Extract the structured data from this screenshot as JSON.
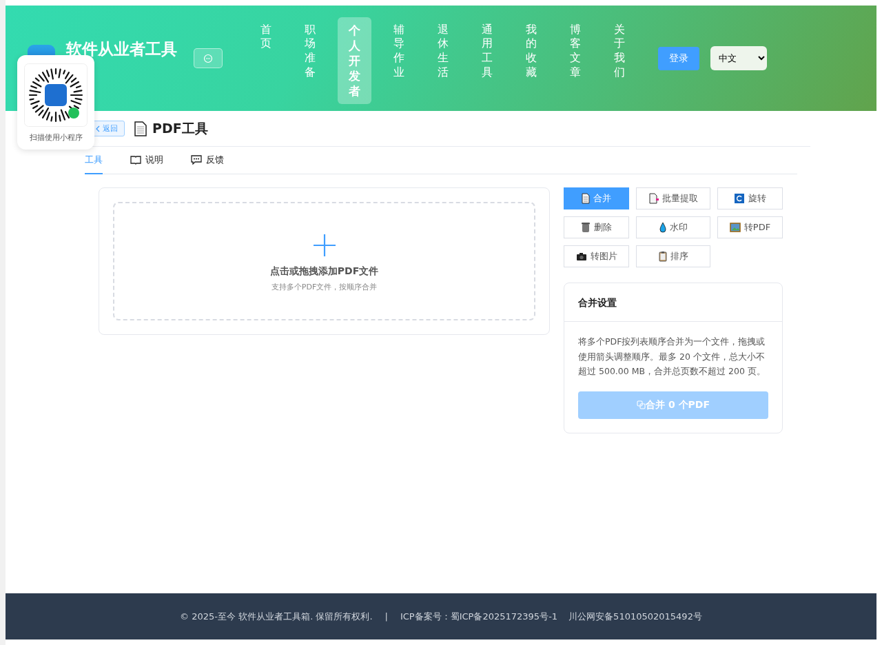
{
  "header": {
    "site_title": "软件从业者工具",
    "nav": [
      {
        "label": "首页",
        "selected": false
      },
      {
        "label": "职场准备",
        "selected": false
      },
      {
        "label": "个人开发者",
        "selected": true
      },
      {
        "label": "辅导作业",
        "selected": false
      },
      {
        "label": "退休生活",
        "selected": false
      },
      {
        "label": "通用工具",
        "selected": false
      },
      {
        "label": "我的收藏",
        "selected": false
      },
      {
        "label": "博客文章",
        "selected": false
      },
      {
        "label": "关于我们",
        "selected": false
      }
    ],
    "login_button": "登录",
    "language": "中文"
  },
  "qr_popup": {
    "caption": "扫描使用小程序"
  },
  "page": {
    "back_button": "返回",
    "title": "PDF工具"
  },
  "tabs": [
    {
      "label": "工具",
      "selected": true
    },
    {
      "label": "说明",
      "selected": false
    },
    {
      "label": "反馈",
      "selected": false
    }
  ],
  "upload": {
    "title": "点击或拖拽添加PDF文件",
    "hint": "支持多个PDF文件，按顺序合并"
  },
  "tools": [
    {
      "label": "合并",
      "selected": true
    },
    {
      "label": "批量提取",
      "selected": false
    },
    {
      "label": "旋转",
      "selected": false
    },
    {
      "label": "删除",
      "selected": false
    },
    {
      "label": "水印",
      "selected": false
    },
    {
      "label": "转PDF",
      "selected": false
    },
    {
      "label": "转图片",
      "selected": false
    },
    {
      "label": "排序",
      "selected": false
    }
  ],
  "settings": {
    "title": "合并设置",
    "description": "将多个PDF按列表顺序合并为一个文件，拖拽或使用箭头调整顺序。最多 20 个文件，总大小不超过 500.00 MB，合并总页数不超过 200 页。",
    "action_button": "合并 0 个PDF",
    "action_disabled": true
  },
  "footer": {
    "copyright": "© 2025-至今 软件从业者工具箱. 保留所有权利.",
    "separator": "|",
    "icp": "ICP备案号：蜀ICP备2025172395号-1",
    "police": "川公网安备51010502015492号"
  }
}
